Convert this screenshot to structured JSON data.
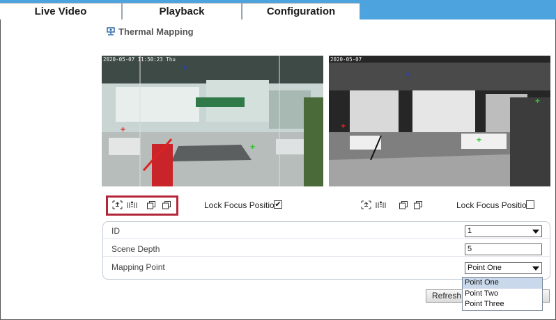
{
  "tabs": [
    {
      "label": "Live Video"
    },
    {
      "label": "Playback"
    },
    {
      "label": "Configuration"
    }
  ],
  "page": {
    "title": "Thermal Mapping",
    "icon": "thermal-camera-icon"
  },
  "video_left": {
    "osd": "2020-05-07 11:50:23 Thu"
  },
  "video_right": {
    "osd": "2020-05-07"
  },
  "toolbar_left": {
    "icons": [
      "zoom-in-icon",
      "zoom-out-icon",
      "copy-icon",
      "paste-icon"
    ],
    "lock_label": "Lock Focus Position",
    "lock_checked": true
  },
  "toolbar_right": {
    "icons": [
      "zoom-in-icon",
      "zoom-out-icon",
      "copy-icon",
      "paste-icon"
    ],
    "lock_label": "Lock Focus Position",
    "lock_checked": false
  },
  "form": {
    "id_label": "ID",
    "id_value": "1",
    "scene_depth_label": "Scene Depth",
    "scene_depth_value": "5",
    "mapping_point_label": "Mapping Point",
    "mapping_point_value": "Point One"
  },
  "dropdown_options": [
    "Point One",
    "Point Two",
    "Point Three"
  ],
  "refresh_label": "Refresh",
  "colors": {
    "tabbar": "#4da3dd",
    "highlight": "#b3263a",
    "marker_red": "#e02020",
    "marker_blue": "#2040d0",
    "marker_green": "#30c030"
  }
}
